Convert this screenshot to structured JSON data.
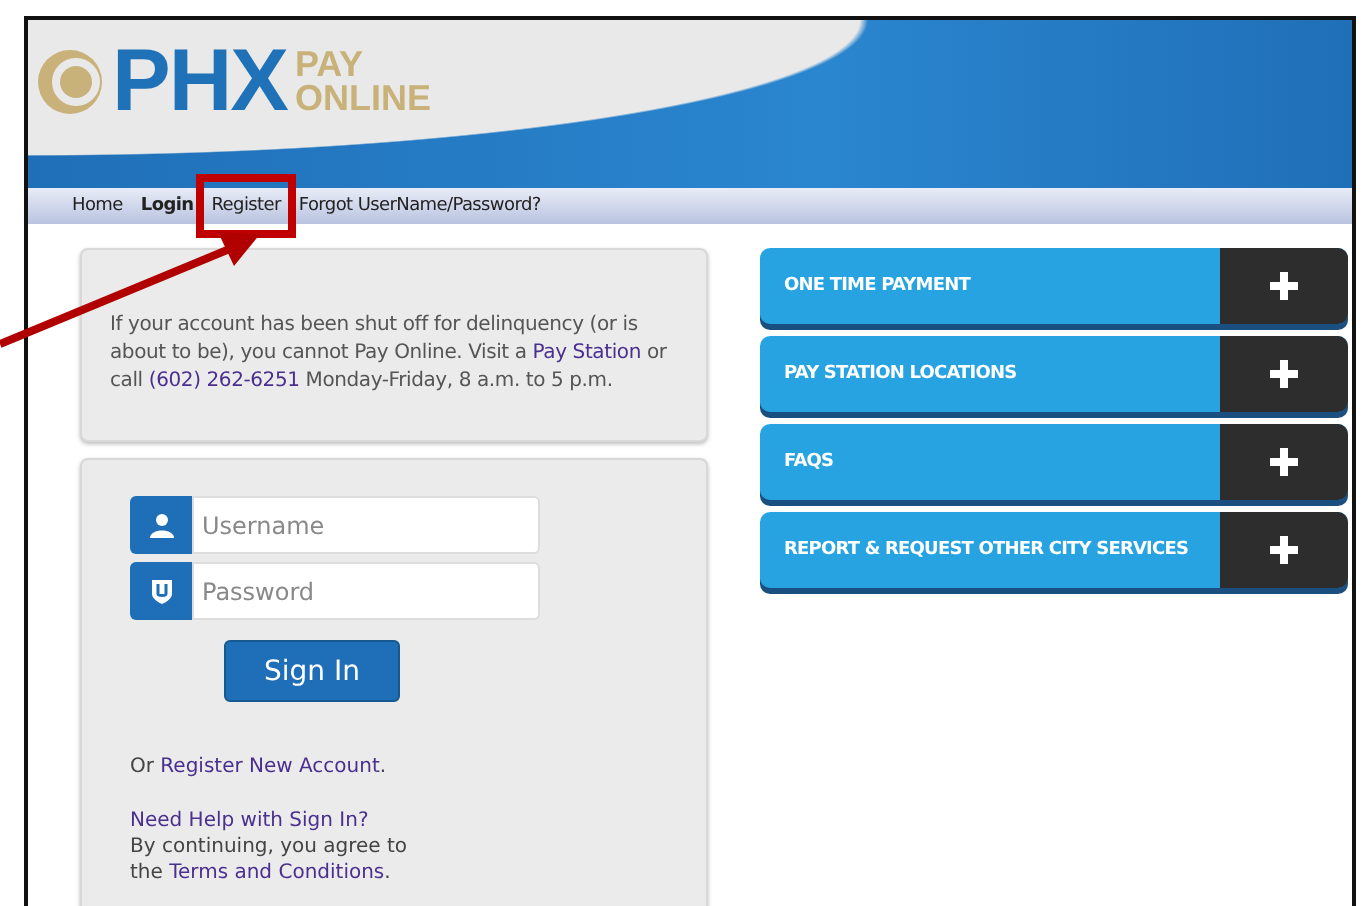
{
  "logo": {
    "mark": "PHX",
    "line_1": "PAY",
    "line_2": "ONLINE"
  },
  "nav": [
    {
      "label": "Home",
      "selected": false
    },
    {
      "label": "Login",
      "selected": true
    },
    {
      "label": "Register",
      "selected": false
    },
    {
      "label": "Forgot UserName/Password?",
      "selected": false
    }
  ],
  "notice": [
    {
      "kind": "text",
      "text": "If your account has been shut off for delinquency (or is about to be), you cannot Pay Online. Visit a "
    },
    {
      "kind": "link",
      "text": "Pay Station"
    },
    {
      "kind": "text",
      "text": " or call "
    },
    {
      "kind": "link",
      "text": "(602) 262-6251"
    },
    {
      "kind": "text",
      "text": " Monday-Friday, 8 a.m. to 5 p.m."
    }
  ],
  "login": {
    "username": {
      "placeholder": "Username"
    },
    "password": {
      "placeholder": "Password"
    },
    "button": "Sign In",
    "register": [
      {
        "kind": "text",
        "text": "Or "
      },
      {
        "kind": "link",
        "text": "Register New Account"
      },
      {
        "kind": "text",
        "text": "."
      }
    ],
    "help": "Need Help with Sign In?",
    "terms": [
      {
        "kind": "text",
        "text": "By continuing, you agree to the "
      },
      {
        "kind": "link",
        "text": "Terms and Conditions"
      },
      {
        "kind": "text",
        "text": "."
      }
    ]
  },
  "panels": [
    {
      "label": "ONE TIME PAYMENT",
      "expanded": false
    },
    {
      "label": "PAY STATION LOCATIONS",
      "expanded": false
    },
    {
      "label": "FAQS",
      "expanded": false
    },
    {
      "label": "REPORT & REQUEST OTHER CITY SERVICES",
      "expanded": false
    }
  ]
}
